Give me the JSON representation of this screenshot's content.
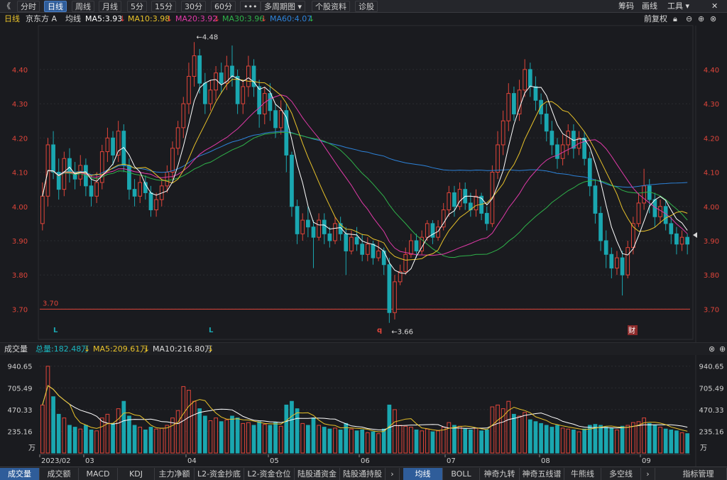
{
  "toolbar": {
    "back": "《",
    "buttons": [
      "分时",
      "日线",
      "周线",
      "月线",
      "5分",
      "15分",
      "30分",
      "60分",
      "•••",
      "多周期图 ▾",
      "个股资料",
      "诊股"
    ],
    "active_index": 1,
    "right": [
      "筹码",
      "画线",
      "工具 ▾"
    ]
  },
  "legend": {
    "period": "日线",
    "stock": "京东方 A",
    "ma_label": "均线",
    "ma5": "MA5:3.93",
    "ma10": "MA10:3.98",
    "ma20": "MA20:3.92",
    "ma30": "MA30:3.96",
    "ma60": "MA60:4.07",
    "arrow": "↓",
    "adjust": "前复权"
  },
  "colors": {
    "up": "#e0453a",
    "down": "#1aa7b0",
    "ma5": "#ffffff",
    "ma10": "#e8c22a",
    "ma20": "#e03aa8",
    "ma30": "#2fb24a",
    "ma60": "#2d82d8",
    "axis_text": "#e0453a",
    "grid": "#2b2c31"
  },
  "price_axis": {
    "ticks": [
      "4.40",
      "4.30",
      "4.20",
      "4.10",
      "4.00",
      "3.90",
      "3.80",
      "3.70"
    ],
    "line_label": "3.70",
    "high_label": "←4.48",
    "low_label": "←3.66",
    "markers": [
      "L",
      "L",
      "q",
      "财"
    ]
  },
  "volume_bar": {
    "title": "成交量",
    "total": "总量:182.48万",
    "ma5": "MA5:209.61万",
    "ma10": "MA10:216.80万",
    "arrow": "↓"
  },
  "volume_axis": {
    "ticks": [
      "940.65",
      "705.49",
      "470.33",
      "235.16"
    ],
    "unit": "万"
  },
  "date_axis": [
    "2023/02",
    "03",
    "04",
    "05",
    "06",
    "07",
    "08",
    "09"
  ],
  "tabs_left": [
    "成交量",
    "成交额",
    "MACD",
    "KDJ",
    "主力净额",
    "L2-资金抄底",
    "L2-资金仓位",
    "陆股通资金",
    "陆股通持股"
  ],
  "tabs_right": [
    "均线",
    "BOLL",
    "神奇九转",
    "神奇五线谱",
    "牛熊线",
    "多空线",
    "指标管理"
  ],
  "chart_data": {
    "type": "candlestick",
    "ylim": [
      3.62,
      4.52
    ],
    "price_axis": [
      3.7,
      3.8,
      3.9,
      4.0,
      4.1,
      4.2,
      4.3,
      4.4
    ],
    "high_point": 4.48,
    "low_point": 3.66,
    "reference_line": 3.7,
    "volume_ylim": [
      0,
      1000
    ],
    "volume_axis": [
      235.16,
      470.33,
      705.49,
      940.65
    ],
    "volume_unit": "万",
    "months": [
      "2023/02",
      "03",
      "04",
      "05",
      "06",
      "07",
      "08",
      "09"
    ],
    "candles": [
      [
        3.95,
        4.03,
        4.07,
        3.93,
        520
      ],
      [
        4.03,
        4.18,
        4.2,
        4.0,
        940
      ],
      [
        4.18,
        4.1,
        4.22,
        4.08,
        610
      ],
      [
        4.1,
        4.05,
        4.14,
        4.02,
        420
      ],
      [
        4.05,
        4.14,
        4.16,
        4.03,
        380
      ],
      [
        4.14,
        4.1,
        4.17,
        4.07,
        300
      ],
      [
        4.1,
        4.08,
        4.13,
        4.05,
        280
      ],
      [
        4.08,
        4.12,
        4.15,
        4.06,
        260
      ],
      [
        4.12,
        4.06,
        4.14,
        4.03,
        300
      ],
      [
        4.06,
        4.03,
        4.09,
        4.0,
        250
      ],
      [
        4.03,
        4.07,
        4.1,
        4.01,
        240
      ],
      [
        4.07,
        4.16,
        4.18,
        4.05,
        380
      ],
      [
        4.16,
        4.2,
        4.23,
        4.13,
        420
      ],
      [
        4.2,
        4.15,
        4.22,
        4.12,
        320
      ],
      [
        4.15,
        4.22,
        4.25,
        4.13,
        480
      ],
      [
        4.22,
        4.12,
        4.24,
        4.1,
        560
      ],
      [
        4.12,
        4.05,
        4.14,
        4.02,
        400
      ],
      [
        4.05,
        4.03,
        4.08,
        4.0,
        300
      ],
      [
        4.03,
        4.07,
        4.09,
        4.01,
        280
      ],
      [
        4.07,
        4.04,
        4.09,
        4.02,
        250
      ],
      [
        4.04,
        3.99,
        4.06,
        3.97,
        280
      ],
      [
        3.99,
        4.02,
        4.04,
        3.97,
        260
      ],
      [
        4.02,
        4.06,
        4.08,
        4.0,
        270
      ],
      [
        4.06,
        4.1,
        4.12,
        4.04,
        300
      ],
      [
        4.1,
        4.17,
        4.19,
        4.08,
        380
      ],
      [
        4.17,
        4.23,
        4.25,
        4.15,
        460
      ],
      [
        4.23,
        4.3,
        4.32,
        4.2,
        720
      ],
      [
        4.3,
        4.38,
        4.42,
        4.27,
        680
      ],
      [
        4.38,
        4.44,
        4.48,
        4.35,
        560
      ],
      [
        4.44,
        4.36,
        4.46,
        4.33,
        480
      ],
      [
        4.36,
        4.3,
        4.39,
        4.27,
        400
      ],
      [
        4.3,
        4.34,
        4.37,
        4.28,
        350
      ],
      [
        4.34,
        4.39,
        4.41,
        4.31,
        380
      ],
      [
        4.39,
        4.36,
        4.42,
        4.33,
        340
      ],
      [
        4.36,
        4.41,
        4.44,
        4.34,
        360
      ],
      [
        4.41,
        4.38,
        4.47,
        4.35,
        400
      ],
      [
        4.38,
        4.3,
        4.4,
        4.27,
        380
      ],
      [
        4.3,
        4.35,
        4.37,
        4.27,
        320
      ],
      [
        4.35,
        4.41,
        4.44,
        4.32,
        330
      ],
      [
        4.41,
        4.35,
        4.43,
        4.32,
        300
      ],
      [
        4.35,
        4.27,
        4.37,
        4.23,
        340
      ],
      [
        4.27,
        4.33,
        4.35,
        4.24,
        310
      ],
      [
        4.33,
        4.28,
        4.36,
        4.25,
        300
      ],
      [
        4.28,
        4.23,
        4.3,
        4.2,
        330
      ],
      [
        4.23,
        4.28,
        4.31,
        4.21,
        290
      ],
      [
        4.28,
        4.15,
        4.3,
        4.1,
        520
      ],
      [
        4.15,
        4.0,
        4.16,
        3.97,
        560
      ],
      [
        4.0,
        3.92,
        4.02,
        3.89,
        480
      ],
      [
        3.92,
        3.96,
        3.98,
        3.9,
        320
      ],
      [
        3.96,
        3.94,
        4.0,
        3.91,
        300
      ],
      [
        3.94,
        3.91,
        3.96,
        3.82,
        380
      ],
      [
        3.91,
        3.96,
        3.98,
        3.9,
        300
      ],
      [
        3.96,
        3.92,
        3.98,
        3.89,
        280
      ],
      [
        3.92,
        3.9,
        3.94,
        3.88,
        260
      ],
      [
        3.9,
        3.95,
        3.97,
        3.89,
        270
      ],
      [
        3.95,
        3.92,
        3.97,
        3.9,
        250
      ],
      [
        3.92,
        3.87,
        3.94,
        3.8,
        320
      ],
      [
        3.87,
        3.91,
        3.93,
        3.86,
        260
      ],
      [
        3.91,
        3.89,
        3.94,
        3.87,
        240
      ],
      [
        3.89,
        3.86,
        3.92,
        3.84,
        250
      ],
      [
        3.86,
        3.89,
        3.91,
        3.84,
        220
      ],
      [
        3.89,
        3.85,
        3.9,
        3.83,
        230
      ],
      [
        3.85,
        3.87,
        3.9,
        3.84,
        210
      ],
      [
        3.87,
        3.83,
        3.88,
        3.8,
        260
      ],
      [
        3.83,
        3.69,
        3.85,
        3.66,
        520
      ],
      [
        3.69,
        3.78,
        3.8,
        3.67,
        470
      ],
      [
        3.78,
        3.81,
        3.83,
        3.77,
        300
      ],
      [
        3.81,
        3.86,
        3.88,
        3.8,
        290
      ],
      [
        3.86,
        3.9,
        3.92,
        3.85,
        280
      ],
      [
        3.9,
        3.87,
        3.92,
        3.85,
        250
      ],
      [
        3.87,
        3.91,
        3.93,
        3.86,
        240
      ],
      [
        3.91,
        3.95,
        3.96,
        3.9,
        260
      ],
      [
        3.95,
        3.91,
        3.96,
        3.89,
        230
      ],
      [
        3.91,
        3.94,
        3.96,
        3.9,
        240
      ],
      [
        3.94,
        3.99,
        4.01,
        3.93,
        280
      ],
      [
        3.99,
        4.04,
        4.06,
        3.97,
        330
      ],
      [
        4.04,
        4.0,
        4.06,
        3.97,
        300
      ],
      [
        4.0,
        4.05,
        4.07,
        3.99,
        290
      ],
      [
        4.05,
        4.01,
        4.07,
        3.99,
        260
      ],
      [
        4.01,
        3.99,
        4.04,
        3.97,
        250
      ],
      [
        3.99,
        4.03,
        4.05,
        3.97,
        270
      ],
      [
        4.03,
        3.98,
        4.04,
        3.96,
        240
      ],
      [
        3.98,
        3.95,
        4.0,
        3.93,
        250
      ],
      [
        3.95,
        4.1,
        4.12,
        3.94,
        500
      ],
      [
        4.1,
        4.18,
        4.22,
        4.08,
        520
      ],
      [
        4.18,
        4.25,
        4.28,
        4.15,
        480
      ],
      [
        4.25,
        4.33,
        4.36,
        4.22,
        560
      ],
      [
        4.33,
        4.27,
        4.35,
        4.25,
        420
      ],
      [
        4.27,
        4.34,
        4.37,
        4.25,
        400
      ],
      [
        4.34,
        4.4,
        4.43,
        4.32,
        440
      ],
      [
        4.4,
        4.35,
        4.42,
        4.32,
        360
      ],
      [
        4.35,
        4.31,
        4.38,
        4.28,
        340
      ],
      [
        4.31,
        4.27,
        4.33,
        4.24,
        320
      ],
      [
        4.27,
        4.22,
        4.3,
        4.19,
        300
      ],
      [
        4.22,
        4.18,
        4.25,
        4.15,
        280
      ],
      [
        4.18,
        4.14,
        4.2,
        4.11,
        300
      ],
      [
        4.14,
        4.18,
        4.21,
        4.12,
        270
      ],
      [
        4.18,
        4.22,
        4.24,
        4.15,
        260
      ],
      [
        4.22,
        4.17,
        4.24,
        4.14,
        250
      ],
      [
        4.17,
        4.2,
        4.22,
        4.15,
        230
      ],
      [
        4.2,
        4.14,
        4.22,
        4.12,
        260
      ],
      [
        4.14,
        4.06,
        4.16,
        4.03,
        300
      ],
      [
        4.06,
        3.98,
        4.08,
        3.95,
        310
      ],
      [
        3.98,
        3.9,
        4.0,
        3.87,
        300
      ],
      [
        3.9,
        3.86,
        3.93,
        3.82,
        280
      ],
      [
        3.86,
        3.82,
        3.88,
        3.79,
        270
      ],
      [
        3.82,
        3.85,
        3.87,
        3.8,
        250
      ],
      [
        3.85,
        3.8,
        3.87,
        3.74,
        290
      ],
      [
        3.8,
        3.88,
        3.9,
        3.79,
        300
      ],
      [
        3.88,
        3.95,
        3.97,
        3.86,
        330
      ],
      [
        3.95,
        4.01,
        4.04,
        3.94,
        340
      ],
      [
        4.01,
        4.06,
        4.11,
        3.99,
        380
      ],
      [
        4.06,
        4.02,
        4.08,
        3.98,
        320
      ],
      [
        4.02,
        3.97,
        4.04,
        3.94,
        300
      ],
      [
        3.97,
        4.0,
        4.02,
        3.95,
        280
      ],
      [
        4.0,
        3.95,
        4.02,
        3.93,
        260
      ],
      [
        3.95,
        3.92,
        3.97,
        3.89,
        250
      ],
      [
        3.92,
        3.89,
        3.94,
        3.86,
        240
      ],
      [
        3.89,
        3.91,
        3.93,
        3.87,
        220
      ],
      [
        3.91,
        3.89,
        3.92,
        3.86,
        210
      ]
    ]
  }
}
